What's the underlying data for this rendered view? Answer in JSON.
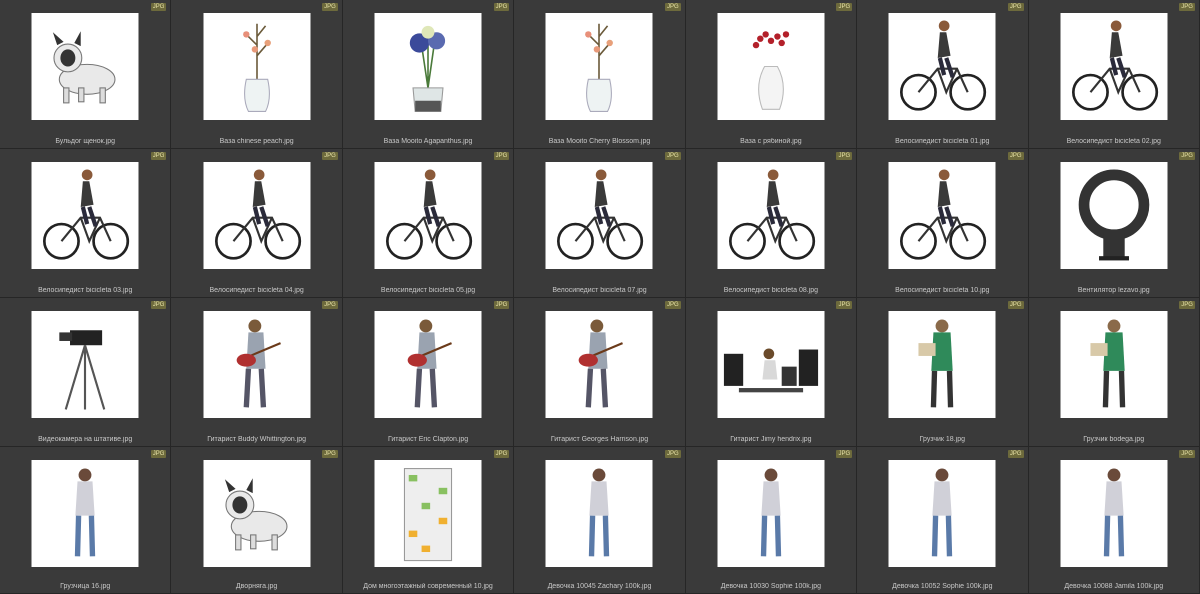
{
  "badge_label": "JPG",
  "items": [
    {
      "name": "Бульдог щенок.jpg",
      "icon": "dog-icon"
    },
    {
      "name": "Ваза chinese peach.jpg",
      "icon": "vase-branch-icon"
    },
    {
      "name": "Ваза Mooito Agapanthus.jpg",
      "icon": "vase-flowers-icon"
    },
    {
      "name": "Ваза Mooito Cherry Blossom.jpg",
      "icon": "vase-branch-icon"
    },
    {
      "name": "Ваза с рябиной.jpg",
      "icon": "vase-berries-icon"
    },
    {
      "name": "Велосипедист bicicleta 01.jpg",
      "icon": "cyclist-icon"
    },
    {
      "name": "Велосипедист bicicleta 02.jpg",
      "icon": "cyclist-icon"
    },
    {
      "name": "Велосипедист bicicleta 03.jpg",
      "icon": "cyclist-icon"
    },
    {
      "name": "Велосипедист bicicleta 04.jpg",
      "icon": "cyclist-icon"
    },
    {
      "name": "Велосипедист bicicleta 05.jpg",
      "icon": "cyclist-icon"
    },
    {
      "name": "Велосипедист bicicleta 07.jpg",
      "icon": "cyclist-icon"
    },
    {
      "name": "Велосипедист bicicleta 08.jpg",
      "icon": "cyclist-icon"
    },
    {
      "name": "Велосипедист bicicleta 10.jpg",
      "icon": "cyclist-icon"
    },
    {
      "name": "Вентилятор lezavo.jpg",
      "icon": "fan-icon"
    },
    {
      "name": "Видеокамера на штативе.jpg",
      "icon": "camera-tripod-icon"
    },
    {
      "name": "Гитарист Buddy Whittington.jpg",
      "icon": "guitarist-icon"
    },
    {
      "name": "Гитарист Eric Clapton.jpg",
      "icon": "guitarist-icon"
    },
    {
      "name": "Гитарист Georges Harrison.jpg",
      "icon": "guitarist-icon"
    },
    {
      "name": "Гитарист Jimy hendrix.jpg",
      "icon": "stage-icon"
    },
    {
      "name": "Грузчик 18.jpg",
      "icon": "worker-icon"
    },
    {
      "name": "Грузчик bodega.jpg",
      "icon": "worker-icon"
    },
    {
      "name": "Грузчица 16.jpg",
      "icon": "person-icon"
    },
    {
      "name": "Дворняга.jpg",
      "icon": "dog-icon"
    },
    {
      "name": "Дом многоэтажный современный 10.jpg",
      "icon": "building-icon"
    },
    {
      "name": "Девочка 10045 Zachary 100k.jpg",
      "icon": "person-icon"
    },
    {
      "name": "Девочка 10030 Sophie 100k.jpg",
      "icon": "person-icon"
    },
    {
      "name": "Девочка 10052 Sophie 100k.jpg",
      "icon": "person-icon"
    },
    {
      "name": "Девочка 10088 Jamila 100k.jpg",
      "icon": "person-icon"
    }
  ]
}
